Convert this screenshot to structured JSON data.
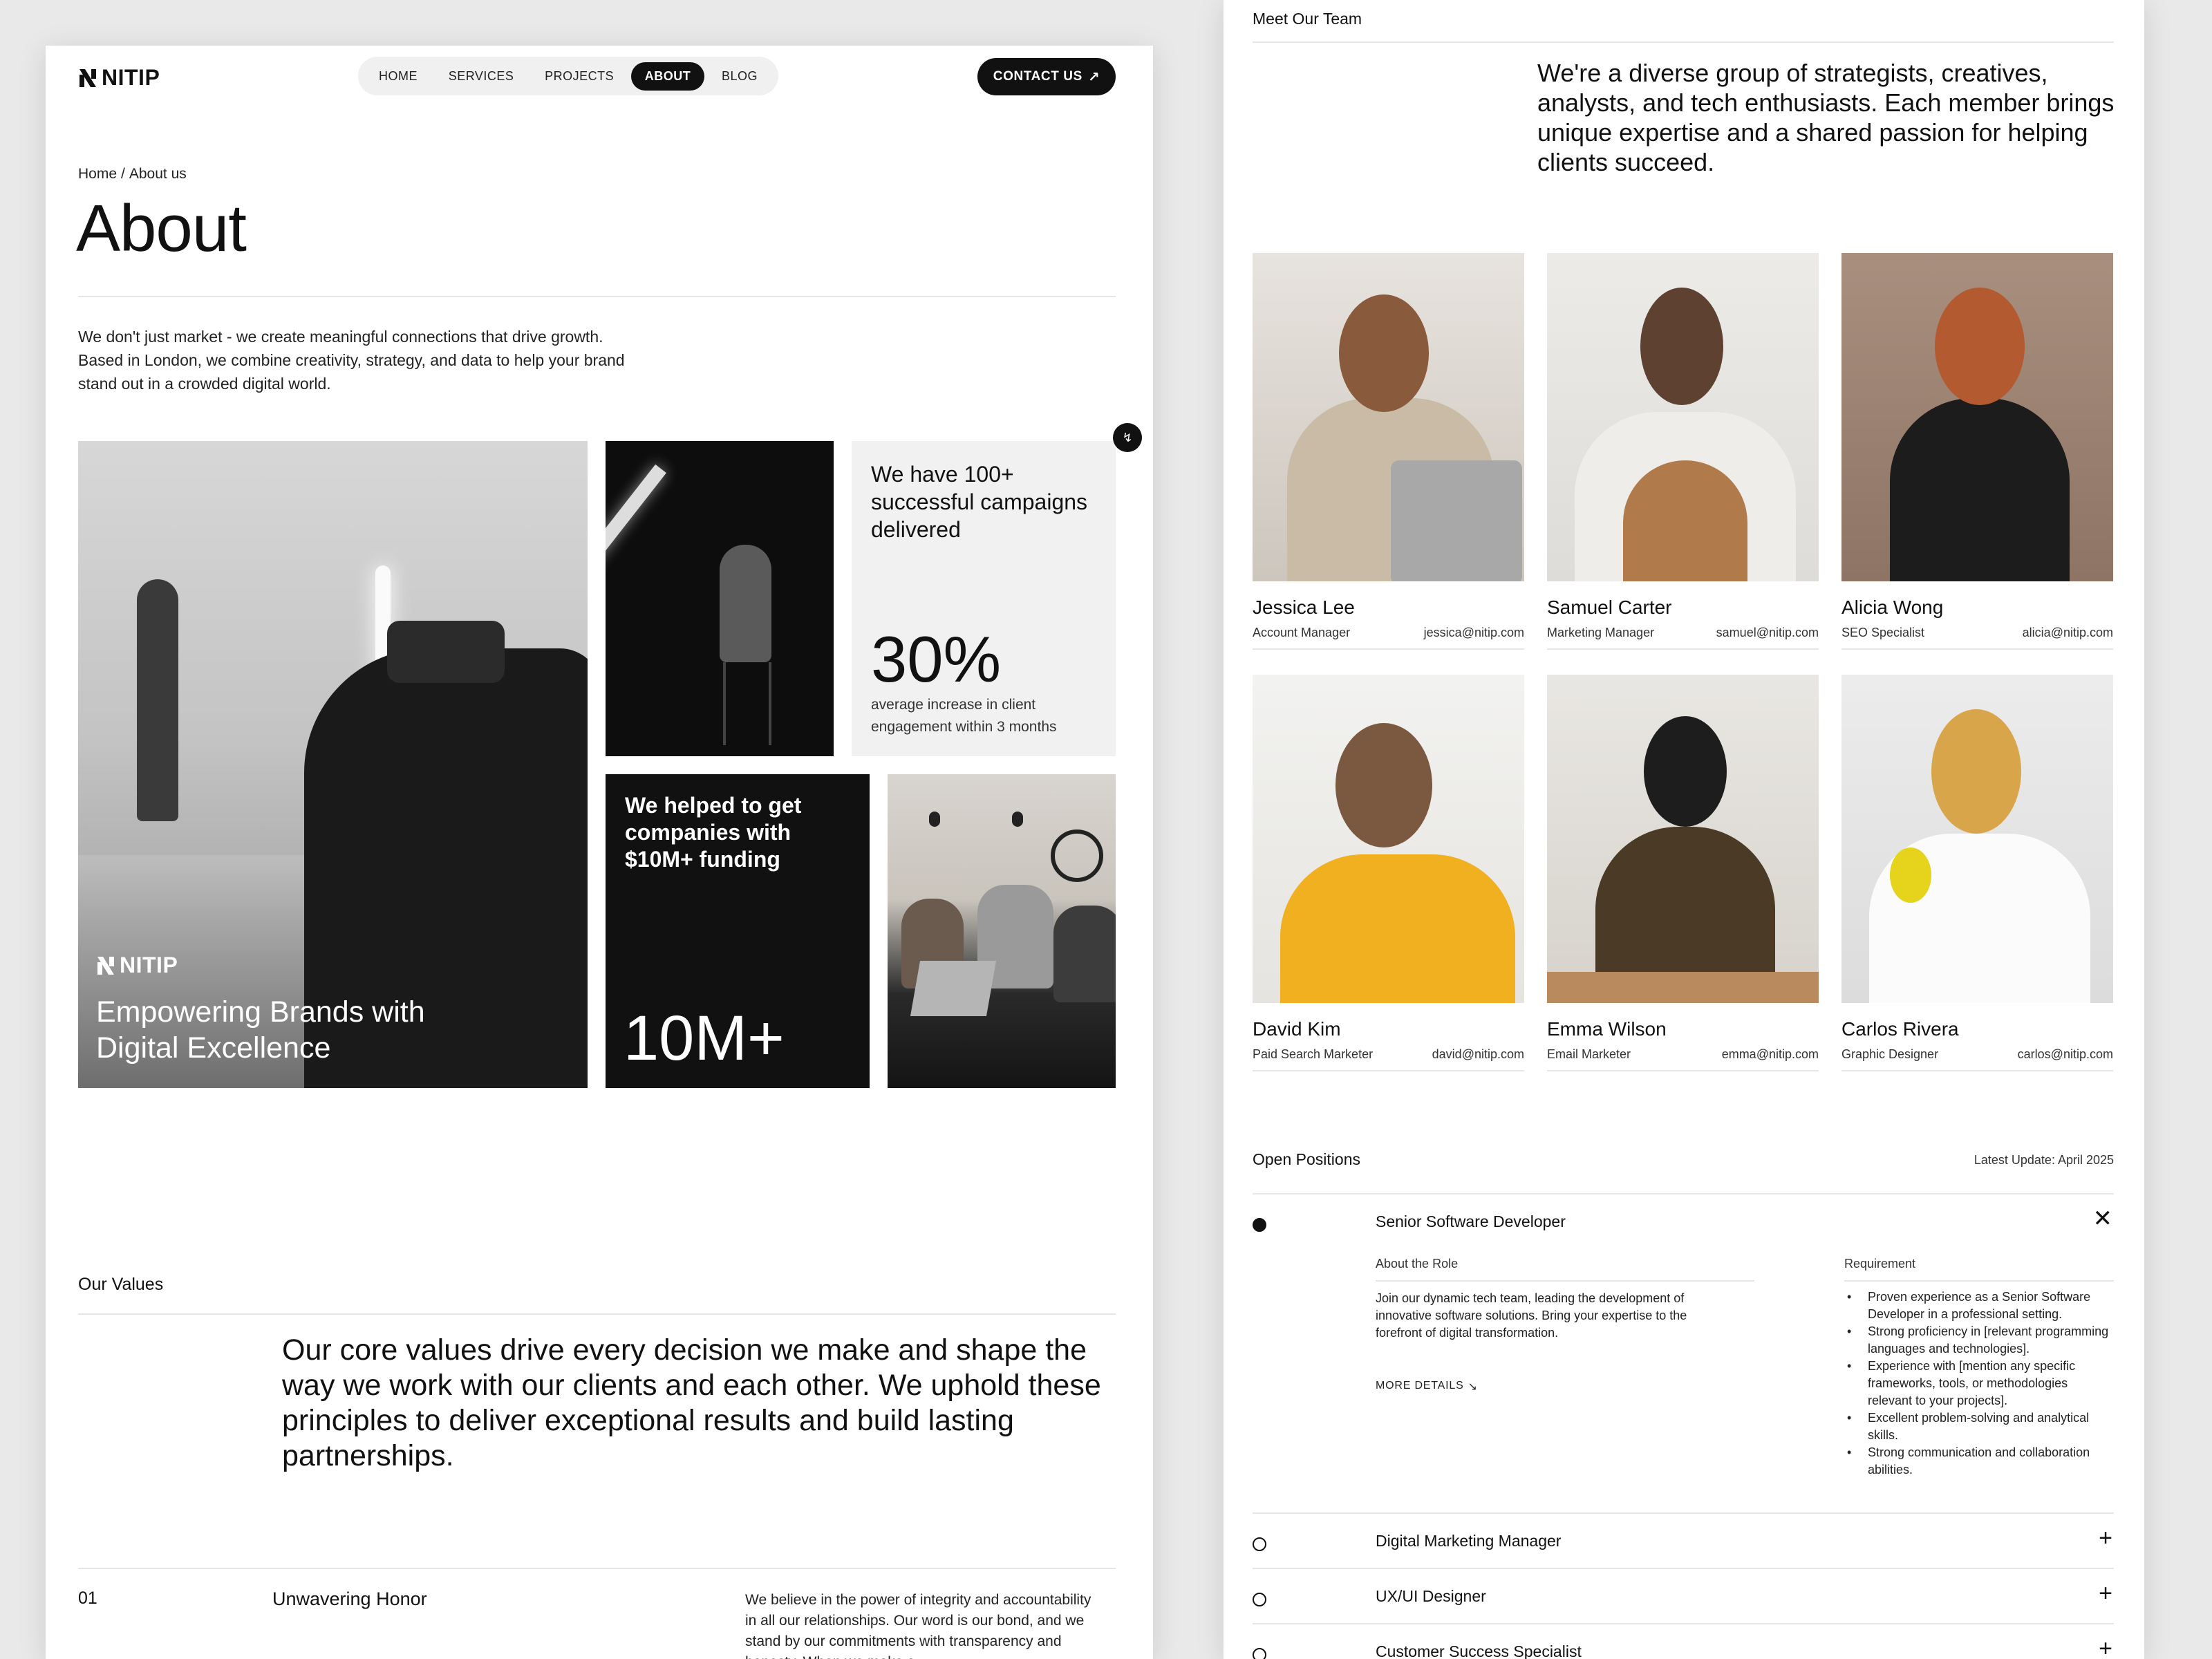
{
  "left": {
    "brand": "NITIP",
    "nav": [
      "HOME",
      "SERVICES",
      "PROJECTS",
      "ABOUT",
      "BLOG"
    ],
    "nav_active": "ABOUT",
    "contact_label": "CONTACT US",
    "breadcrumb": [
      "Home",
      "/",
      "About us"
    ],
    "page_title": "About",
    "intro": "We don't just market - we create meaningful connections that drive growth. Based in London, we combine creativity, strategy, and data to help your brand stand out in a crowded digital world.",
    "hero_brand": "NITIP",
    "hero_title": "Empowering Brands with Digital Excellence",
    "stat_campaigns": "We have 100+ successful campaigns delivered",
    "stat_percent": "30%",
    "stat_percent_desc": "average increase in client engagement within 3 months",
    "funding_text": "We helped to get companies with $10M+ funding",
    "funding_big": "10M+",
    "values_label": "Our Values",
    "values_text": "Our core values drive every decision we make and shape the way we work with our clients and each other. We uphold these principles to deliver exceptional results and build lasting partnerships.",
    "value_1": {
      "num": "01",
      "title": "Unwavering Honor",
      "desc": "We believe in the power of integrity and accountability in all our relationships. Our word is our bond, and we stand by our commitments with transparency and honesty. When we make a"
    }
  },
  "right": {
    "team_label": "Meet Our Team",
    "team_intro": "We're a diverse group of strategists, creatives, analysts, and tech enthusiasts. Each member brings unique expertise and a shared passion for helping clients succeed.",
    "members": [
      {
        "name": "Jessica Lee",
        "role": "Account Manager",
        "email": "jessica@nitip.com"
      },
      {
        "name": "Samuel Carter",
        "role": "Marketing Manager",
        "email": "samuel@nitip.com"
      },
      {
        "name": "Alicia Wong",
        "role": "SEO Specialist",
        "email": "alicia@nitip.com"
      },
      {
        "name": "David Kim",
        "role": "Paid Search Marketer",
        "email": "david@nitip.com"
      },
      {
        "name": "Emma Wilson",
        "role": "Email Marketer",
        "email": "emma@nitip.com"
      },
      {
        "name": "Carlos Rivera",
        "role": "Graphic Designer",
        "email": "carlos@nitip.com"
      }
    ],
    "positions_label": "Open Positions",
    "positions_update": "Latest Update: April 2025",
    "positions": [
      {
        "title": "Senior Software Developer",
        "expanded": true
      },
      {
        "title": "Digital Marketing Manager",
        "expanded": false
      },
      {
        "title": "UX/UI Designer",
        "expanded": false
      },
      {
        "title": "Customer Success Specialist",
        "expanded": false
      }
    ],
    "role_about_heading": "About the Role",
    "role_about": "Join our dynamic tech team, leading the development of innovative software solutions. Bring your expertise to the forefront of digital transformation.",
    "more_details": "MORE DETAILS",
    "requirement_heading": "Requirement",
    "requirements": [
      "Proven experience as a Senior Software Developer in a professional setting.",
      "Strong proficiency in [relevant programming languages and technologies].",
      "Experience with [mention any specific frameworks, tools, or methodologies relevant to your projects].",
      "Excellent problem-solving and analytical skills.",
      "Strong communication and collaboration abilities."
    ]
  },
  "colors": {
    "accent": "#111111",
    "panel": "#f1f1f1",
    "divider": "#e6e6e6"
  }
}
